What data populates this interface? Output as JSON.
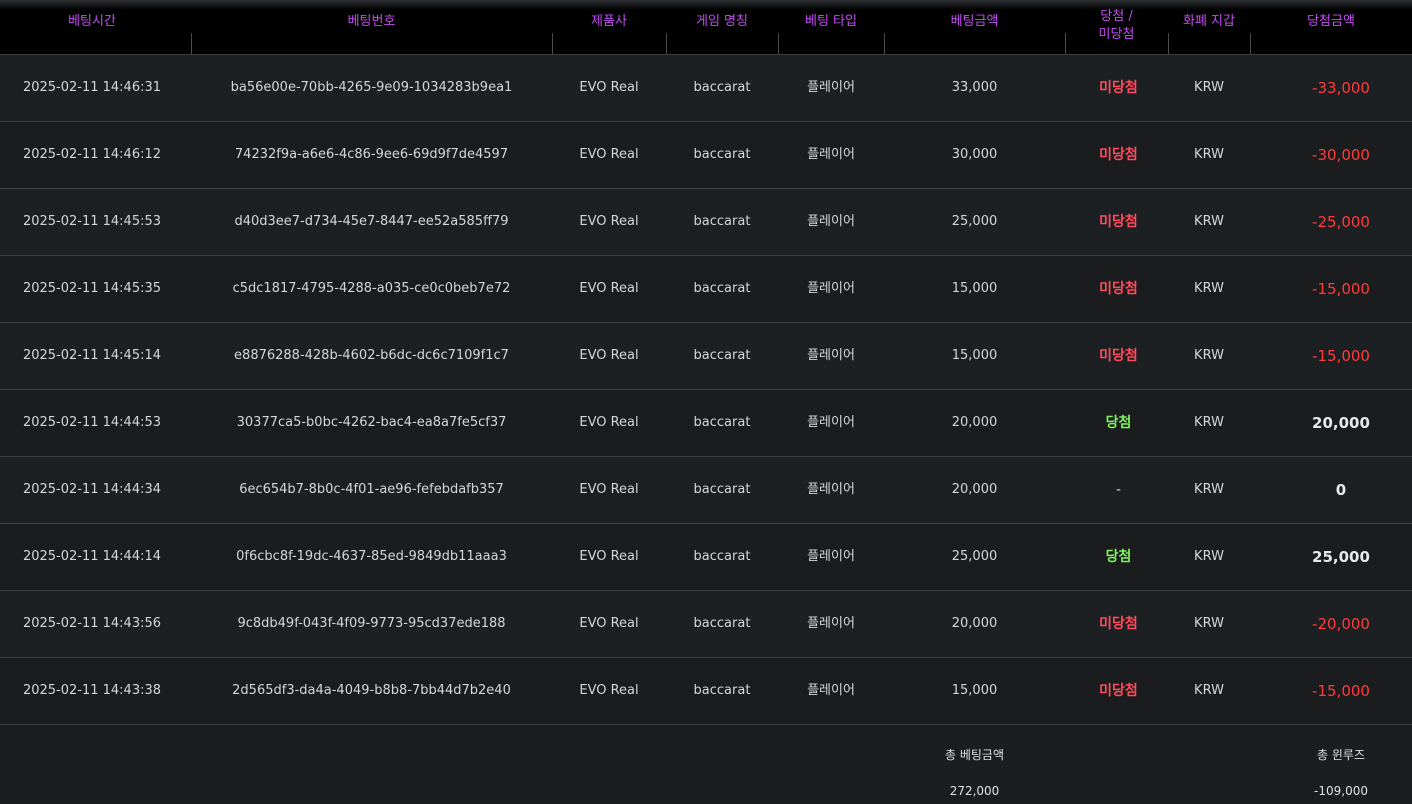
{
  "table": {
    "headers": {
      "time": "베팅시간",
      "bet_id": "베팅번호",
      "provider": "제품사",
      "game": "게임 명칭",
      "bet_type": "베팅 타입",
      "bet_amount": "베팅금액",
      "result_line1": "당첨 /",
      "result_line2": "미당첨",
      "wallet": "화폐 지갑",
      "win_amount": "당첨금액"
    },
    "rows": [
      {
        "time": "2025-02-11 14:46:31",
        "bet_id": "ba56e00e-70bb-4265-9e09-1034283b9ea1",
        "provider": "EVO Real",
        "game": "baccarat",
        "bet_type": "플레이어",
        "bet_amount": "33,000",
        "result": "미당첨",
        "wallet": "KRW",
        "win_amount": "-33,000"
      },
      {
        "time": "2025-02-11 14:46:12",
        "bet_id": "74232f9a-a6e6-4c86-9ee6-69d9f7de4597",
        "provider": "EVO Real",
        "game": "baccarat",
        "bet_type": "플레이어",
        "bet_amount": "30,000",
        "result": "미당첨",
        "wallet": "KRW",
        "win_amount": "-30,000"
      },
      {
        "time": "2025-02-11 14:45:53",
        "bet_id": "d40d3ee7-d734-45e7-8447-ee52a585ff79",
        "provider": "EVO Real",
        "game": "baccarat",
        "bet_type": "플레이어",
        "bet_amount": "25,000",
        "result": "미당첨",
        "wallet": "KRW",
        "win_amount": "-25,000"
      },
      {
        "time": "2025-02-11 14:45:35",
        "bet_id": "c5dc1817-4795-4288-a035-ce0c0beb7e72",
        "provider": "EVO Real",
        "game": "baccarat",
        "bet_type": "플레이어",
        "bet_amount": "15,000",
        "result": "미당첨",
        "wallet": "KRW",
        "win_amount": "-15,000"
      },
      {
        "time": "2025-02-11 14:45:14",
        "bet_id": "e8876288-428b-4602-b6dc-dc6c7109f1c7",
        "provider": "EVO Real",
        "game": "baccarat",
        "bet_type": "플레이어",
        "bet_amount": "15,000",
        "result": "미당첨",
        "wallet": "KRW",
        "win_amount": "-15,000"
      },
      {
        "time": "2025-02-11 14:44:53",
        "bet_id": "30377ca5-b0bc-4262-bac4-ea8a7fe5cf37",
        "provider": "EVO Real",
        "game": "baccarat",
        "bet_type": "플레이어",
        "bet_amount": "20,000",
        "result": "당첨",
        "wallet": "KRW",
        "win_amount": "20,000"
      },
      {
        "time": "2025-02-11 14:44:34",
        "bet_id": "6ec654b7-8b0c-4f01-ae96-fefebdafb357",
        "provider": "EVO Real",
        "game": "baccarat",
        "bet_type": "플레이어",
        "bet_amount": "20,000",
        "result": "-",
        "wallet": "KRW",
        "win_amount": "0"
      },
      {
        "time": "2025-02-11 14:44:14",
        "bet_id": "0f6cbc8f-19dc-4637-85ed-9849db11aaa3",
        "provider": "EVO Real",
        "game": "baccarat",
        "bet_type": "플레이어",
        "bet_amount": "25,000",
        "result": "당첨",
        "wallet": "KRW",
        "win_amount": "25,000"
      },
      {
        "time": "2025-02-11 14:43:56",
        "bet_id": "9c8db49f-043f-4f09-9773-95cd37ede188",
        "provider": "EVO Real",
        "game": "baccarat",
        "bet_type": "플레이어",
        "bet_amount": "20,000",
        "result": "미당첨",
        "wallet": "KRW",
        "win_amount": "-20,000"
      },
      {
        "time": "2025-02-11 14:43:38",
        "bet_id": "2d565df3-da4a-4049-b8b8-7bb44d7b2e40",
        "provider": "EVO Real",
        "game": "baccarat",
        "bet_type": "플레이어",
        "bet_amount": "15,000",
        "result": "미당첨",
        "wallet": "KRW",
        "win_amount": "-15,000"
      }
    ]
  },
  "summary": {
    "total_bet_label": "총 베팅금액",
    "total_bet_value": "272,000",
    "total_winloss_label": "총 윈루즈",
    "total_winloss_value": "-109,000"
  },
  "colors": {
    "header_text": "#c34cf2",
    "lose": "#ff4b5c",
    "win": "#7ef25e",
    "negative_amount": "#ff3b3b"
  }
}
